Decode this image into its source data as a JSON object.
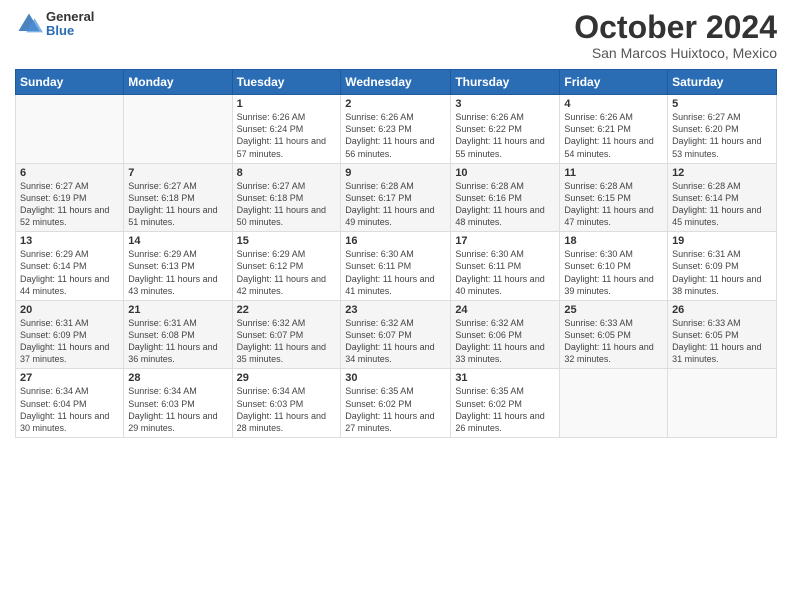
{
  "header": {
    "logo": {
      "general": "General",
      "blue": "Blue"
    },
    "title": "October 2024",
    "location": "San Marcos Huixtoco, Mexico"
  },
  "weekdays": [
    "Sunday",
    "Monday",
    "Tuesday",
    "Wednesday",
    "Thursday",
    "Friday",
    "Saturday"
  ],
  "weeks": [
    [
      {
        "day": "",
        "info": ""
      },
      {
        "day": "",
        "info": ""
      },
      {
        "day": "1",
        "info": "Sunrise: 6:26 AM\nSunset: 6:24 PM\nDaylight: 11 hours and 57 minutes."
      },
      {
        "day": "2",
        "info": "Sunrise: 6:26 AM\nSunset: 6:23 PM\nDaylight: 11 hours and 56 minutes."
      },
      {
        "day": "3",
        "info": "Sunrise: 6:26 AM\nSunset: 6:22 PM\nDaylight: 11 hours and 55 minutes."
      },
      {
        "day": "4",
        "info": "Sunrise: 6:26 AM\nSunset: 6:21 PM\nDaylight: 11 hours and 54 minutes."
      },
      {
        "day": "5",
        "info": "Sunrise: 6:27 AM\nSunset: 6:20 PM\nDaylight: 11 hours and 53 minutes."
      }
    ],
    [
      {
        "day": "6",
        "info": "Sunrise: 6:27 AM\nSunset: 6:19 PM\nDaylight: 11 hours and 52 minutes."
      },
      {
        "day": "7",
        "info": "Sunrise: 6:27 AM\nSunset: 6:18 PM\nDaylight: 11 hours and 51 minutes."
      },
      {
        "day": "8",
        "info": "Sunrise: 6:27 AM\nSunset: 6:18 PM\nDaylight: 11 hours and 50 minutes."
      },
      {
        "day": "9",
        "info": "Sunrise: 6:28 AM\nSunset: 6:17 PM\nDaylight: 11 hours and 49 minutes."
      },
      {
        "day": "10",
        "info": "Sunrise: 6:28 AM\nSunset: 6:16 PM\nDaylight: 11 hours and 48 minutes."
      },
      {
        "day": "11",
        "info": "Sunrise: 6:28 AM\nSunset: 6:15 PM\nDaylight: 11 hours and 47 minutes."
      },
      {
        "day": "12",
        "info": "Sunrise: 6:28 AM\nSunset: 6:14 PM\nDaylight: 11 hours and 45 minutes."
      }
    ],
    [
      {
        "day": "13",
        "info": "Sunrise: 6:29 AM\nSunset: 6:14 PM\nDaylight: 11 hours and 44 minutes."
      },
      {
        "day": "14",
        "info": "Sunrise: 6:29 AM\nSunset: 6:13 PM\nDaylight: 11 hours and 43 minutes."
      },
      {
        "day": "15",
        "info": "Sunrise: 6:29 AM\nSunset: 6:12 PM\nDaylight: 11 hours and 42 minutes."
      },
      {
        "day": "16",
        "info": "Sunrise: 6:30 AM\nSunset: 6:11 PM\nDaylight: 11 hours and 41 minutes."
      },
      {
        "day": "17",
        "info": "Sunrise: 6:30 AM\nSunset: 6:11 PM\nDaylight: 11 hours and 40 minutes."
      },
      {
        "day": "18",
        "info": "Sunrise: 6:30 AM\nSunset: 6:10 PM\nDaylight: 11 hours and 39 minutes."
      },
      {
        "day": "19",
        "info": "Sunrise: 6:31 AM\nSunset: 6:09 PM\nDaylight: 11 hours and 38 minutes."
      }
    ],
    [
      {
        "day": "20",
        "info": "Sunrise: 6:31 AM\nSunset: 6:09 PM\nDaylight: 11 hours and 37 minutes."
      },
      {
        "day": "21",
        "info": "Sunrise: 6:31 AM\nSunset: 6:08 PM\nDaylight: 11 hours and 36 minutes."
      },
      {
        "day": "22",
        "info": "Sunrise: 6:32 AM\nSunset: 6:07 PM\nDaylight: 11 hours and 35 minutes."
      },
      {
        "day": "23",
        "info": "Sunrise: 6:32 AM\nSunset: 6:07 PM\nDaylight: 11 hours and 34 minutes."
      },
      {
        "day": "24",
        "info": "Sunrise: 6:32 AM\nSunset: 6:06 PM\nDaylight: 11 hours and 33 minutes."
      },
      {
        "day": "25",
        "info": "Sunrise: 6:33 AM\nSunset: 6:05 PM\nDaylight: 11 hours and 32 minutes."
      },
      {
        "day": "26",
        "info": "Sunrise: 6:33 AM\nSunset: 6:05 PM\nDaylight: 11 hours and 31 minutes."
      }
    ],
    [
      {
        "day": "27",
        "info": "Sunrise: 6:34 AM\nSunset: 6:04 PM\nDaylight: 11 hours and 30 minutes."
      },
      {
        "day": "28",
        "info": "Sunrise: 6:34 AM\nSunset: 6:03 PM\nDaylight: 11 hours and 29 minutes."
      },
      {
        "day": "29",
        "info": "Sunrise: 6:34 AM\nSunset: 6:03 PM\nDaylight: 11 hours and 28 minutes."
      },
      {
        "day": "30",
        "info": "Sunrise: 6:35 AM\nSunset: 6:02 PM\nDaylight: 11 hours and 27 minutes."
      },
      {
        "day": "31",
        "info": "Sunrise: 6:35 AM\nSunset: 6:02 PM\nDaylight: 11 hours and 26 minutes."
      },
      {
        "day": "",
        "info": ""
      },
      {
        "day": "",
        "info": ""
      }
    ]
  ]
}
